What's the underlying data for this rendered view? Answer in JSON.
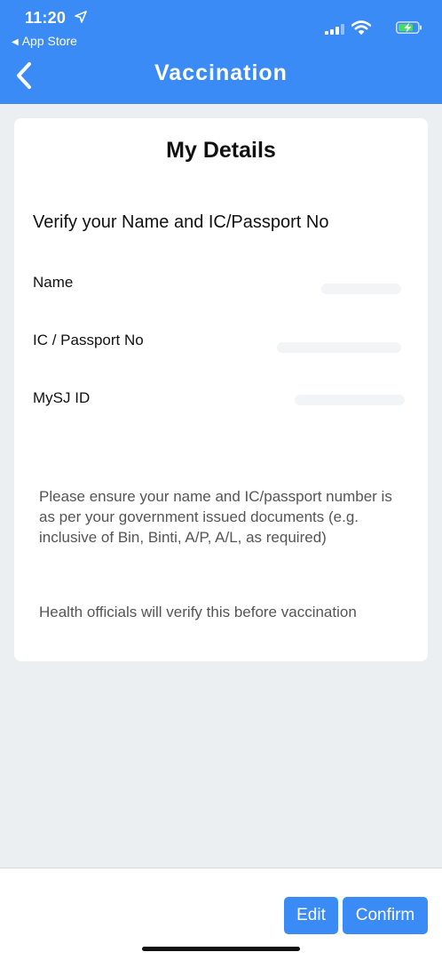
{
  "status_bar": {
    "time": "11:20",
    "back_app": "App Store",
    "icons": [
      "location-arrow-icon",
      "signal-icon",
      "wifi-icon",
      "battery-charging-icon"
    ]
  },
  "nav": {
    "title": "Vaccination",
    "back_icon": "chevron-left-icon"
  },
  "card": {
    "title": "My Details",
    "subtitle": "Verify your Name and IC/Passport No",
    "fields": [
      {
        "label": "Name",
        "value": ""
      },
      {
        "label": "IC / Passport No",
        "value": ""
      },
      {
        "label": "MySJ ID",
        "value": ""
      }
    ],
    "note_1": "Please ensure your name and IC/passport number is as per your government issued documents (e.g. inclusive of Bin, Binti, A/P, A/L, as required)",
    "note_2": "Health officials will verify this before vaccination"
  },
  "actions": {
    "edit_label": "Edit",
    "confirm_label": "Confirm"
  },
  "colors": {
    "accent": "#3b8bf6",
    "background": "#eceff1",
    "card": "#ffffff"
  }
}
